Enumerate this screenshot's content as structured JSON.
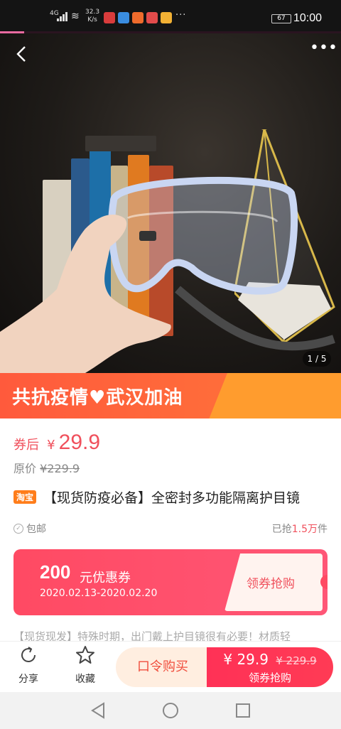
{
  "status_bar": {
    "network": "4G",
    "speed": "32.3",
    "speed_unit": "K/s",
    "battery": "67",
    "time": "10:00",
    "app_icon_colors": [
      "#d93c3c",
      "#3a8de0",
      "#ef6b2c",
      "#e24b4b",
      "#f2b134"
    ]
  },
  "hero": {
    "image_subject": "clear protective goggles held in hand",
    "counter": "1 / 5",
    "back_icon": "back-arrow-icon",
    "more_icon": "more-dots-icon"
  },
  "banner": {
    "text_left": "共抗疫情",
    "heart": "♥",
    "text_right": "武汉加油",
    "colors": {
      "left": "#ff5a3c",
      "right": "#ff9c2e"
    }
  },
  "product": {
    "coupon_after_label": "券后",
    "currency": "¥",
    "price": "29.9",
    "original_label": "原价",
    "original_price": "¥229.9",
    "platform_badge": "淘宝",
    "title": "【现货防疫必备】全密封多功能隔离护目镜",
    "free_shipping": "包邮",
    "sold_prefix": "已抢",
    "sold_count": "1.5万",
    "sold_suffix": "件",
    "description": "【现货现发】特殊时期，出门戴上护目镜很有必要！材质轻"
  },
  "coupon": {
    "amount": "200",
    "amount_label": "元优惠券",
    "dates": "2020.02.13-2020.02.20",
    "action": "领券抢购"
  },
  "action_bar": {
    "share_label": "分享",
    "favorite_label": "收藏",
    "code_buy_label": "口令购买",
    "buy_price": "¥ 29.9",
    "buy_old_price": "¥ 229.9",
    "buy_label": "领券抢购"
  },
  "colors": {
    "accent": "#f0505c",
    "buy_button": "#ff3156",
    "code_button_bg": "#ffeee0"
  }
}
